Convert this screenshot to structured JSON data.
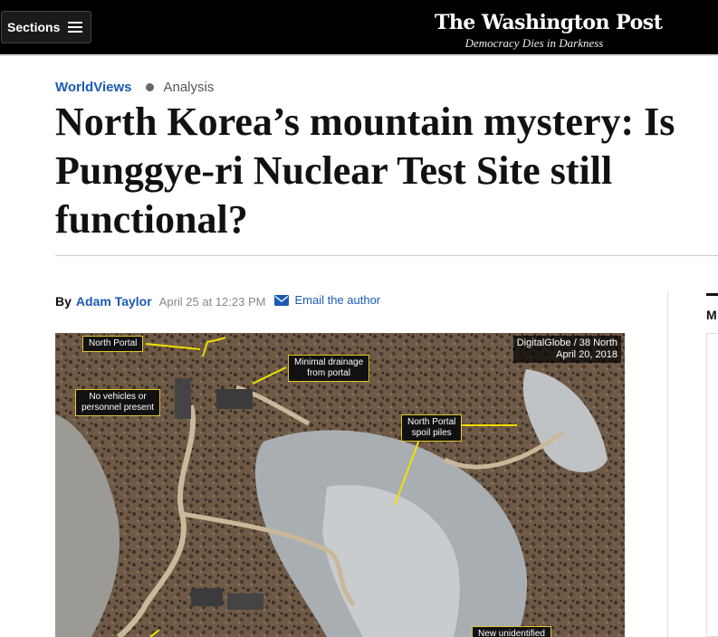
{
  "header": {
    "sections_label": "Sections",
    "logo_text": "The Washington Post",
    "tagline": "Democracy Dies in Darkness"
  },
  "article": {
    "kicker_section": "WorldViews",
    "kicker_label": "Analysis",
    "headline": "North Korea’s mountain mystery: Is\nPunggye-ri Nuclear Test Site still\nfunctional?",
    "byline_prefix": "By",
    "author": "Adam Taylor",
    "date": "April 25 at 12:23 PM",
    "email_label": "Email the author"
  },
  "photo": {
    "credit_line1": "DigitalGlobe / 38 North",
    "credit_line2": "April 20, 2018",
    "callouts": {
      "north_portal": "North Portal",
      "minimal_drainage": "Minimal drainage\nfrom portal",
      "no_vehicles": "No vehicles or\npersonnel present",
      "spoil_piles": "North Portal\nspoil piles",
      "new_unidentified": "New unidentified"
    }
  },
  "right_rail": {
    "partial_letter": "M"
  },
  "colors": {
    "link_blue": "#1a5ab2",
    "topbar": "#000000",
    "callout_arrow": "#f2e000"
  }
}
